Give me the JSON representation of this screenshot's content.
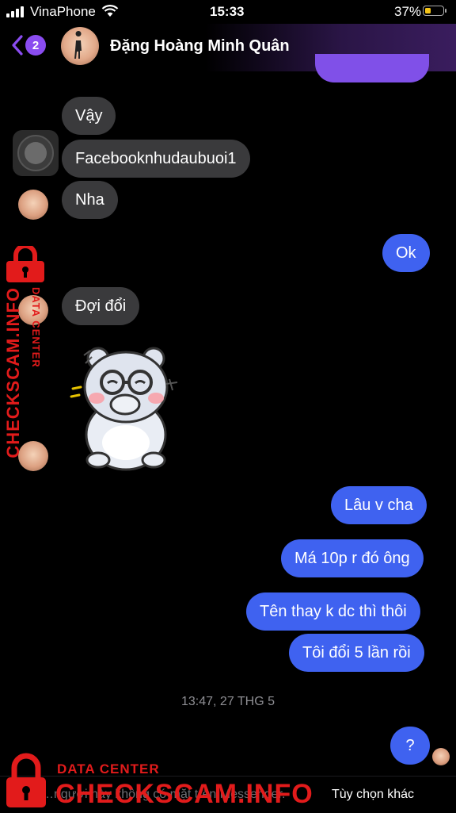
{
  "status_bar": {
    "carrier": "VinaPhone",
    "time": "15:33",
    "battery_percent": "37%",
    "battery_level": 0.37
  },
  "header": {
    "back_badge": "2",
    "contact_name": "Đặng Hoàng Minh Quân"
  },
  "messages": [
    {
      "side": "in",
      "text": "Vậy"
    },
    {
      "side": "in",
      "text": "Facebooknhudaubuoi1"
    },
    {
      "side": "in",
      "text": "Nha"
    },
    {
      "side": "out",
      "text": "Ok"
    },
    {
      "side": "in",
      "text": "Đợi đổi"
    },
    {
      "side": "out",
      "text": "Lâu v cha"
    },
    {
      "side": "out",
      "text": "Má 10p r đó ông"
    },
    {
      "side": "out",
      "text": "Tên thay k dc thì thôi"
    },
    {
      "side": "out",
      "text": "Tôi đổi 5 lần rồi"
    },
    {
      "side": "out",
      "text": "?"
    }
  ],
  "timestamp": "13:47, 27 THG 5",
  "sticker": "bear-covering-mouth-sticker",
  "bottom_bar": {
    "notice": "…người này không có mặt trên Messenger.",
    "options": "Tùy chọn khác"
  },
  "watermark": {
    "line1": "DATA CENTER",
    "line2": "CHECKSCAM.INFO"
  },
  "colors": {
    "incoming": "#3a3a3c",
    "outgoing": "#3f62f0",
    "accent": "#8a4cf0",
    "watermark": "#e21b1b"
  }
}
